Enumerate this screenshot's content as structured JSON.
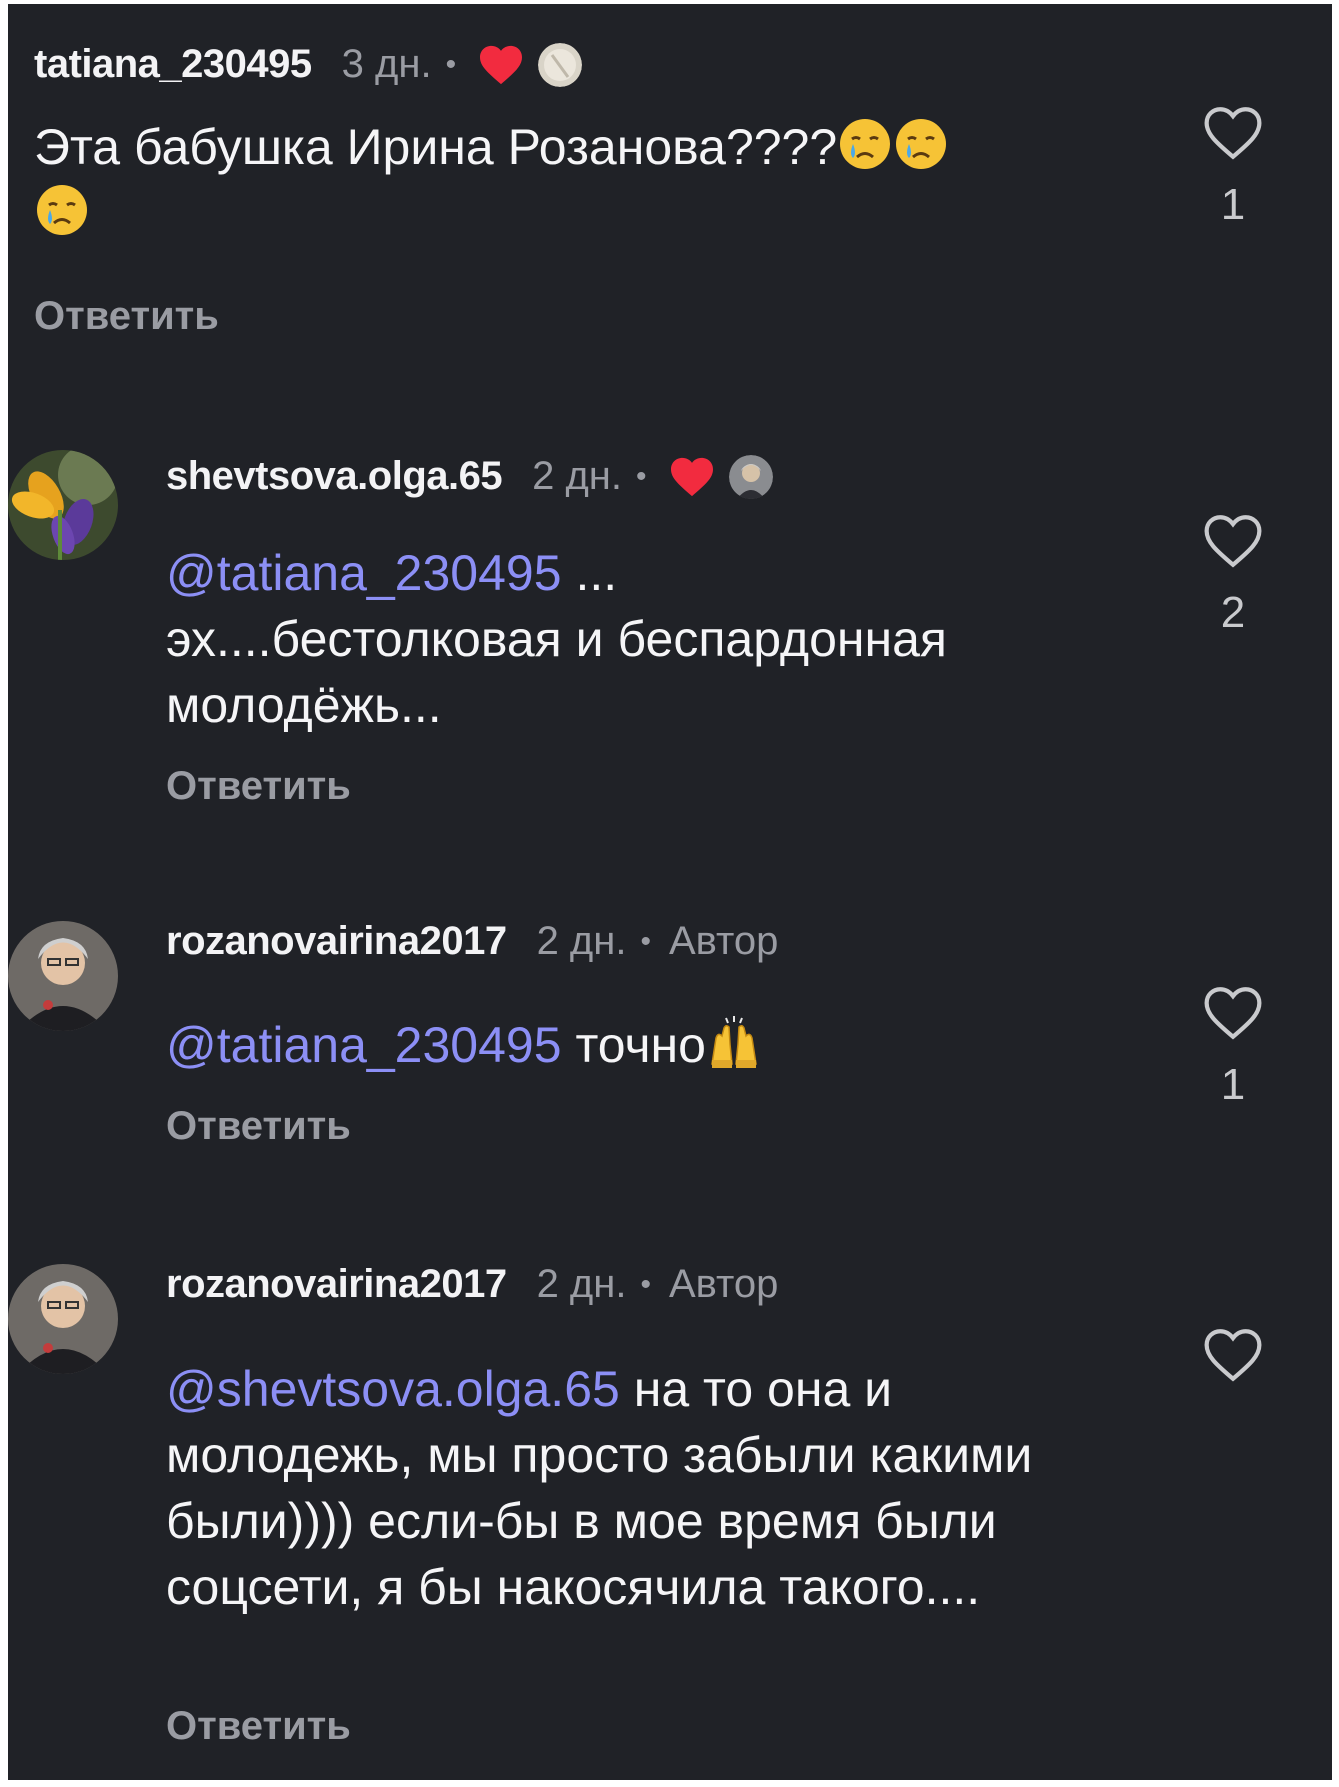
{
  "comments": [
    {
      "username": "tatiana_230495",
      "time": "3 дн.",
      "dot": "•",
      "text": "Эта бабушка Ирина Розанова????",
      "emojis": [
        "crying-face-icon",
        "crying-face-icon",
        "crying-face-icon"
      ],
      "reply_label": "Ответить",
      "likes": "1"
    },
    {
      "username": "shevtsova.olga.65",
      "time": "2 дн.",
      "dot": "•",
      "mention": "@tatiana_230495",
      "text_after_mention": " ...",
      "text_rest": "эх....бестолковая и беспардонная молодёжь...",
      "reply_label": "Ответить",
      "likes": "2"
    },
    {
      "username": "rozanovairina2017",
      "time": "2 дн.",
      "dot": "•",
      "author_badge": "Автор",
      "mention": "@tatiana_230495",
      "text": " точно",
      "emoji": "raising-hands-icon",
      "reply_label": "Ответить",
      "likes": "1"
    },
    {
      "username": "rozanovairina2017",
      "time": "2 дн.",
      "dot": "•",
      "author_badge": "Автор",
      "mention": "@shevtsova.olga.65",
      "text": " на то она и молодежь, мы просто забыли какими были)))) если-бы в мое время были соцсети, я бы накосячила такого....",
      "reply_label": "Ответить",
      "likes": ""
    }
  ],
  "colors": {
    "background": "#202227",
    "mention": "#8c8ff5",
    "like_red": "#f22b3f",
    "muted": "#9a9ca3"
  }
}
